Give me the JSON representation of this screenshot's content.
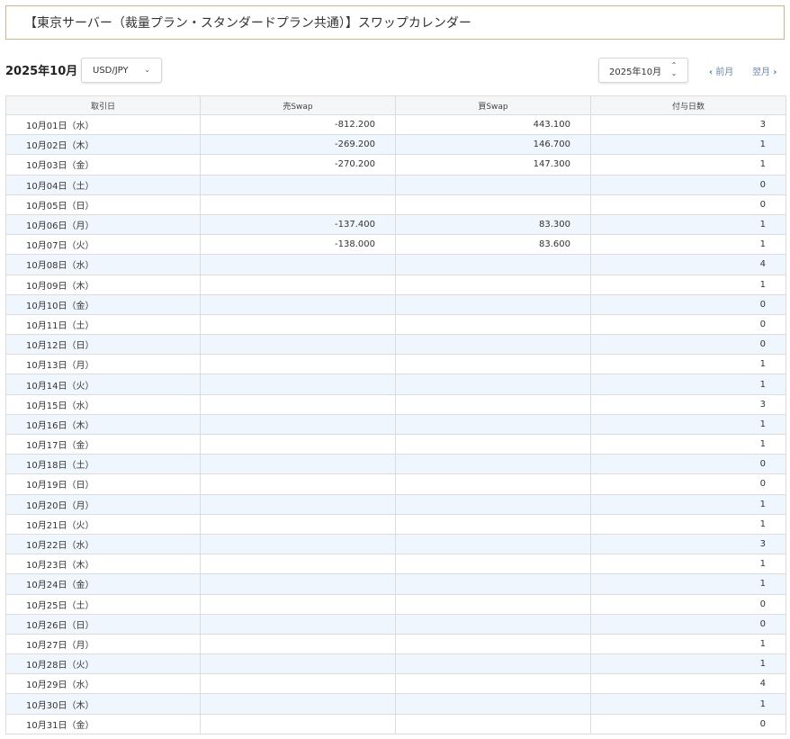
{
  "header": {
    "title": "【東京サーバー（裁量プラン・スタンダードプラン共通）】スワップカレンダー"
  },
  "controls": {
    "month_label": "2025年10月",
    "currency_pair": "USD/JPY",
    "month_select": "2025年10月",
    "prev_label": "前月",
    "next_label": "翌月"
  },
  "table": {
    "columns": [
      "取引日",
      "売Swap",
      "買Swap",
      "付与日数"
    ],
    "rows": [
      {
        "date": "10月01日（水）",
        "sell": "-812.200",
        "buy": "443.100",
        "days": "3"
      },
      {
        "date": "10月02日（木）",
        "sell": "-269.200",
        "buy": "146.700",
        "days": "1"
      },
      {
        "date": "10月03日（金）",
        "sell": "-270.200",
        "buy": "147.300",
        "days": "1"
      },
      {
        "date": "10月04日（土）",
        "sell": "",
        "buy": "",
        "days": "0"
      },
      {
        "date": "10月05日（日）",
        "sell": "",
        "buy": "",
        "days": "0"
      },
      {
        "date": "10月06日（月）",
        "sell": "-137.400",
        "buy": "83.300",
        "days": "1"
      },
      {
        "date": "10月07日（火）",
        "sell": "-138.000",
        "buy": "83.600",
        "days": "1"
      },
      {
        "date": "10月08日（水）",
        "sell": "",
        "buy": "",
        "days": "4"
      },
      {
        "date": "10月09日（木）",
        "sell": "",
        "buy": "",
        "days": "1"
      },
      {
        "date": "10月10日（金）",
        "sell": "",
        "buy": "",
        "days": "0"
      },
      {
        "date": "10月11日（土）",
        "sell": "",
        "buy": "",
        "days": "0"
      },
      {
        "date": "10月12日（日）",
        "sell": "",
        "buy": "",
        "days": "0"
      },
      {
        "date": "10月13日（月）",
        "sell": "",
        "buy": "",
        "days": "1"
      },
      {
        "date": "10月14日（火）",
        "sell": "",
        "buy": "",
        "days": "1"
      },
      {
        "date": "10月15日（水）",
        "sell": "",
        "buy": "",
        "days": "3"
      },
      {
        "date": "10月16日（木）",
        "sell": "",
        "buy": "",
        "days": "1"
      },
      {
        "date": "10月17日（金）",
        "sell": "",
        "buy": "",
        "days": "1"
      },
      {
        "date": "10月18日（土）",
        "sell": "",
        "buy": "",
        "days": "0"
      },
      {
        "date": "10月19日（日）",
        "sell": "",
        "buy": "",
        "days": "0"
      },
      {
        "date": "10月20日（月）",
        "sell": "",
        "buy": "",
        "days": "1"
      },
      {
        "date": "10月21日（火）",
        "sell": "",
        "buy": "",
        "days": "1"
      },
      {
        "date": "10月22日（水）",
        "sell": "",
        "buy": "",
        "days": "3"
      },
      {
        "date": "10月23日（木）",
        "sell": "",
        "buy": "",
        "days": "1"
      },
      {
        "date": "10月24日（金）",
        "sell": "",
        "buy": "",
        "days": "1"
      },
      {
        "date": "10月25日（土）",
        "sell": "",
        "buy": "",
        "days": "0"
      },
      {
        "date": "10月26日（日）",
        "sell": "",
        "buy": "",
        "days": "0"
      },
      {
        "date": "10月27日（月）",
        "sell": "",
        "buy": "",
        "days": "1"
      },
      {
        "date": "10月28日（火）",
        "sell": "",
        "buy": "",
        "days": "1"
      },
      {
        "date": "10月29日（水）",
        "sell": "",
        "buy": "",
        "days": "4"
      },
      {
        "date": "10月30日（木）",
        "sell": "",
        "buy": "",
        "days": "1"
      },
      {
        "date": "10月31日（金）",
        "sell": "",
        "buy": "",
        "days": "0"
      }
    ]
  },
  "icons": {
    "pair_dropdown": "chevron-down-icon",
    "month_stepper": "up-down-arrows-icon",
    "prev": "chevron-left-icon",
    "next": "chevron-right-icon"
  },
  "colors": {
    "title_border": "#c8b78c",
    "row_stripe": "#f0f6fd",
    "header_bg": "#f5f6f8",
    "nav_link": "#6f86a8"
  }
}
